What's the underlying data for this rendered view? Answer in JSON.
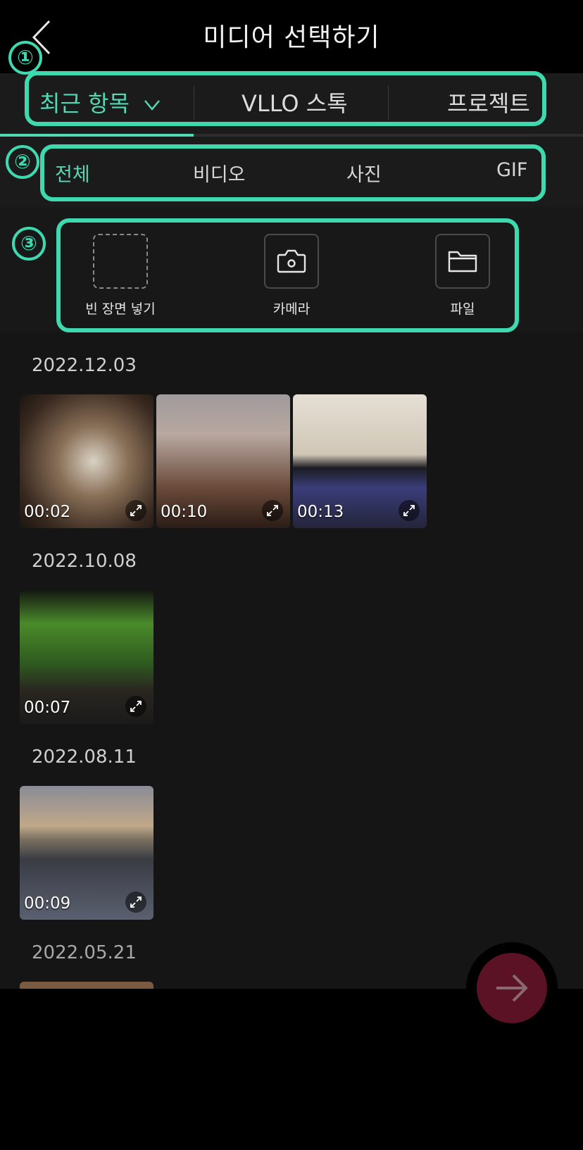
{
  "header": {
    "title": "미디어 선택하기",
    "back_icon": "chevron-left-icon"
  },
  "source_tabs": [
    {
      "label": "최근 항목",
      "selected": true,
      "icon": "chevron-down-icon"
    },
    {
      "label": "VLLO 스톡",
      "selected": false
    },
    {
      "label": "프로젝트",
      "selected": false
    }
  ],
  "type_tabs": [
    {
      "label": "전체",
      "selected": true
    },
    {
      "label": "비디오",
      "selected": false
    },
    {
      "label": "사진",
      "selected": false
    },
    {
      "label": "GIF",
      "selected": false
    }
  ],
  "actions": [
    {
      "label": "빈 장면 넣기",
      "icon": "blank-frame-icon"
    },
    {
      "label": "카메라",
      "icon": "camera-icon"
    },
    {
      "label": "파일",
      "icon": "folder-icon"
    }
  ],
  "annotations": [
    "①",
    "②",
    "③"
  ],
  "groups": [
    {
      "date": "2022.12.03",
      "items": [
        {
          "duration": "00:02"
        },
        {
          "duration": "00:10"
        },
        {
          "duration": "00:13"
        }
      ]
    },
    {
      "date": "2022.10.08",
      "items": [
        {
          "duration": "00:07"
        }
      ]
    },
    {
      "date": "2022.08.11",
      "items": [
        {
          "duration": "00:09"
        }
      ]
    },
    {
      "date": "2022.05.21",
      "items": []
    }
  ],
  "colors": {
    "accent": "#52d9b3",
    "annotation": "#3fd9b0",
    "next_button": "#5b1224"
  },
  "next_button_icon": "arrow-right-icon"
}
